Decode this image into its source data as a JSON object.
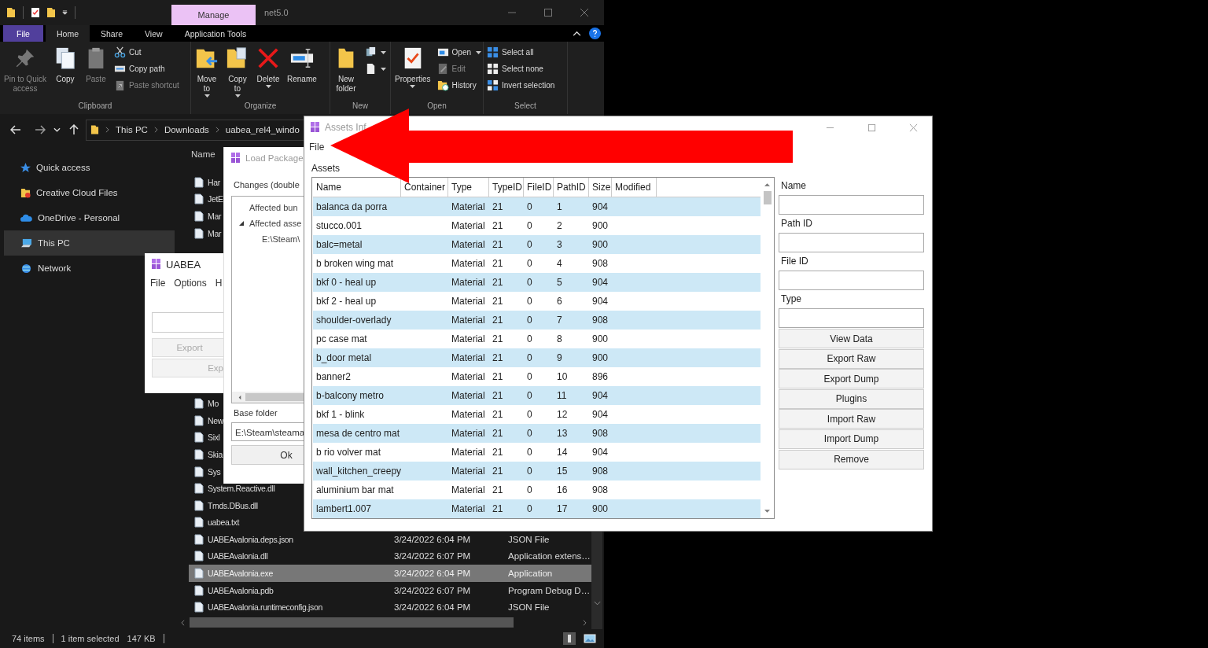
{
  "explorer": {
    "context_tab": {
      "label": "Manage"
    },
    "title": "net5.0",
    "ribbon_tabs": [
      {
        "label": "File",
        "kind": "file",
        "selected": false
      },
      {
        "label": "Home",
        "kind": "tab",
        "selected": true
      },
      {
        "label": "Share",
        "kind": "tab",
        "selected": false
      },
      {
        "label": "View",
        "kind": "tab",
        "selected": false
      },
      {
        "label": "Application Tools",
        "kind": "tab",
        "selected": false
      }
    ],
    "ribbon_groups": [
      {
        "label": "Clipboard",
        "columns": [
          [
            {
              "kind": "large",
              "lines": [
                "Pin to Quick",
                "access"
              ],
              "disabled": true,
              "dropdown": false
            }
          ],
          [
            {
              "kind": "large",
              "lines": [
                "Copy"
              ],
              "disabled": false,
              "dropdown": false
            }
          ],
          [
            {
              "kind": "large",
              "lines": [
                "Paste"
              ],
              "disabled": true,
              "dropdown": false
            }
          ],
          [
            {
              "kind": "small",
              "lines": [
                "Cut"
              ],
              "disabled": false,
              "dropdown": false
            },
            {
              "kind": "small",
              "lines": [
                "Copy path"
              ],
              "disabled": false,
              "dropdown": false
            },
            {
              "kind": "small",
              "lines": [
                "Paste shortcut"
              ],
              "disabled": true,
              "dropdown": false
            }
          ]
        ]
      },
      {
        "label": "Organize",
        "columns": [
          [
            {
              "kind": "large",
              "lines": [
                "Move",
                "to"
              ],
              "disabled": false,
              "dropdown": true
            }
          ],
          [
            {
              "kind": "large",
              "lines": [
                "Copy",
                "to"
              ],
              "disabled": false,
              "dropdown": true
            }
          ],
          [
            {
              "kind": "large",
              "lines": [
                "Delete"
              ],
              "disabled": false,
              "dropdown": true
            }
          ],
          [
            {
              "kind": "large",
              "lines": [
                "Rename"
              ],
              "disabled": false,
              "dropdown": false
            }
          ]
        ]
      },
      {
        "label": "New",
        "columns": [
          [
            {
              "kind": "large",
              "lines": [
                "New",
                "folder"
              ],
              "disabled": false,
              "dropdown": false
            }
          ],
          [
            {
              "kind": "icon",
              "dropdown": true
            },
            {
              "kind": "icon",
              "dropdown": true
            }
          ]
        ]
      },
      {
        "label": "Open",
        "columns": [
          [
            {
              "kind": "large",
              "lines": [
                "Properties"
              ],
              "disabled": false,
              "dropdown": true
            }
          ],
          [
            {
              "kind": "small",
              "lines": [
                "Open"
              ],
              "disabled": false,
              "dropdown": true
            },
            {
              "kind": "small",
              "lines": [
                "Edit"
              ],
              "disabled": true,
              "dropdown": false
            },
            {
              "kind": "small",
              "lines": [
                "History"
              ],
              "disabled": false,
              "dropdown": false
            }
          ]
        ]
      },
      {
        "label": "Select",
        "columns": [
          [
            {
              "kind": "small",
              "lines": [
                "Select all"
              ],
              "disabled": false,
              "dropdown": false
            },
            {
              "kind": "small",
              "lines": [
                "Select none"
              ],
              "disabled": false,
              "dropdown": false
            },
            {
              "kind": "small",
              "lines": [
                "Invert selection"
              ],
              "disabled": false,
              "dropdown": false
            }
          ]
        ]
      }
    ],
    "breadcrumbs": [
      "This PC",
      "Downloads",
      "uabea_rel4_windo"
    ],
    "nav_items": [
      {
        "label": "Quick access",
        "selected": false
      },
      {
        "label": "Creative Cloud Files",
        "selected": false
      },
      {
        "label": "OneDrive - Personal",
        "selected": false
      },
      {
        "label": "This PC",
        "selected": true
      },
      {
        "label": "Network",
        "selected": false
      }
    ],
    "name_column": "Name",
    "files_upper": [
      {
        "name": "Har",
        "selected": false
      },
      {
        "name": "JetE",
        "selected": false
      },
      {
        "name": "Mar",
        "selected": false
      },
      {
        "name": "Mar",
        "selected": false
      }
    ],
    "files_lower": [
      {
        "name": "Mo",
        "selected": false
      },
      {
        "name": "New",
        "selected": false
      },
      {
        "name": "Sixl",
        "selected": false
      },
      {
        "name": "Skia",
        "selected": false
      },
      {
        "name": "Sys",
        "selected": false
      },
      {
        "name": "System.Reactive.dll",
        "selected": false
      },
      {
        "name": "Tmds.DBus.dll",
        "selected": false
      },
      {
        "name": "uabea.txt",
        "selected": false
      },
      {
        "name": "UABEAvalonia.deps.json",
        "modified": "3/24/2022 6:04 PM",
        "type": "JSON File",
        "selected": false
      },
      {
        "name": "UABEAvalonia.dll",
        "modified": "3/24/2022 6:07 PM",
        "type": "Application extens…",
        "selected": false
      },
      {
        "name": "UABEAvalonia.exe",
        "modified": "3/24/2022 6:04 PM",
        "type": "Application",
        "selected": true
      },
      {
        "name": "UABEAvalonia.pdb",
        "modified": "3/24/2022 6:07 PM",
        "type": "Program Debug D…",
        "selected": false
      },
      {
        "name": "UABEAvalonia.runtimeconfig.json",
        "modified": "3/24/2022 6:04 PM",
        "type": "JSON File",
        "selected": false
      }
    ],
    "status_bar": {
      "item_count": "74 items",
      "selection": "1 item selected",
      "size": "147 KB"
    }
  },
  "uabea_window": {
    "title": "UABEA",
    "menu": [
      "File",
      "Options",
      "H"
    ],
    "buttons": [
      {
        "label": "Export",
        "disabled": true
      },
      {
        "label": "Exp",
        "disabled": true
      }
    ]
  },
  "load_package_window": {
    "title": "Load Package",
    "changes_label": "Changes (double",
    "tree": [
      {
        "label": "Affected bun",
        "expanded": false
      },
      {
        "label": "Affected asse",
        "expanded": true,
        "children": [
          {
            "label": "E:\\Steam\\"
          }
        ]
      }
    ],
    "base_folder_label": "Base folder",
    "base_folder_value": "E:\\Steam\\steama",
    "ok_button": "Ok"
  },
  "assets_window": {
    "title": "Assets Inf",
    "menu": [
      "File"
    ],
    "assets_label": "Assets",
    "columns": [
      "Name",
      "Container",
      "Type",
      "TypeID",
      "FileID",
      "PathID",
      "Size",
      "Modified"
    ],
    "rows": [
      {
        "name": "balanca da porra",
        "type": "Material",
        "type_id": "21",
        "file_id": "0",
        "path_id": "1",
        "size": "904"
      },
      {
        "name": "stucco.001",
        "type": "Material",
        "type_id": "21",
        "file_id": "0",
        "path_id": "2",
        "size": "900"
      },
      {
        "name": "balc=metal",
        "type": "Material",
        "type_id": "21",
        "file_id": "0",
        "path_id": "3",
        "size": "900"
      },
      {
        "name": "b broken wing mat",
        "type": "Material",
        "type_id": "21",
        "file_id": "0",
        "path_id": "4",
        "size": "908"
      },
      {
        "name": "bkf 0 - heal up",
        "type": "Material",
        "type_id": "21",
        "file_id": "0",
        "path_id": "5",
        "size": "904"
      },
      {
        "name": "bkf 2 - heal up",
        "type": "Material",
        "type_id": "21",
        "file_id": "0",
        "path_id": "6",
        "size": "904"
      },
      {
        "name": "shoulder-overlady",
        "type": "Material",
        "type_id": "21",
        "file_id": "0",
        "path_id": "7",
        "size": "908"
      },
      {
        "name": "pc case mat",
        "type": "Material",
        "type_id": "21",
        "file_id": "0",
        "path_id": "8",
        "size": "900"
      },
      {
        "name": "b_door metal",
        "type": "Material",
        "type_id": "21",
        "file_id": "0",
        "path_id": "9",
        "size": "900"
      },
      {
        "name": "banner2",
        "type": "Material",
        "type_id": "21",
        "file_id": "0",
        "path_id": "10",
        "size": "896"
      },
      {
        "name": "b-balcony metro",
        "type": "Material",
        "type_id": "21",
        "file_id": "0",
        "path_id": "11",
        "size": "904"
      },
      {
        "name": "bkf 1 - blink",
        "type": "Material",
        "type_id": "21",
        "file_id": "0",
        "path_id": "12",
        "size": "904"
      },
      {
        "name": "mesa de centro mat",
        "type": "Material",
        "type_id": "21",
        "file_id": "0",
        "path_id": "13",
        "size": "908"
      },
      {
        "name": "b rio volver mat",
        "type": "Material",
        "type_id": "21",
        "file_id": "0",
        "path_id": "14",
        "size": "904"
      },
      {
        "name": "wall_kitchen_creepy",
        "type": "Material",
        "type_id": "21",
        "file_id": "0",
        "path_id": "15",
        "size": "908"
      },
      {
        "name": "aluminium bar mat",
        "type": "Material",
        "type_id": "21",
        "file_id": "0",
        "path_id": "16",
        "size": "908"
      },
      {
        "name": "lambert1.007",
        "type": "Material",
        "type_id": "21",
        "file_id": "0",
        "path_id": "17",
        "size": "900"
      }
    ],
    "fields": [
      {
        "label": "Name"
      },
      {
        "label": "Path ID"
      },
      {
        "label": "File ID"
      },
      {
        "label": "Type"
      }
    ],
    "buttons": [
      "View Data",
      "Export Raw",
      "Export Dump",
      "Plugins",
      "Import Raw",
      "Import Dump",
      "Remove"
    ]
  }
}
